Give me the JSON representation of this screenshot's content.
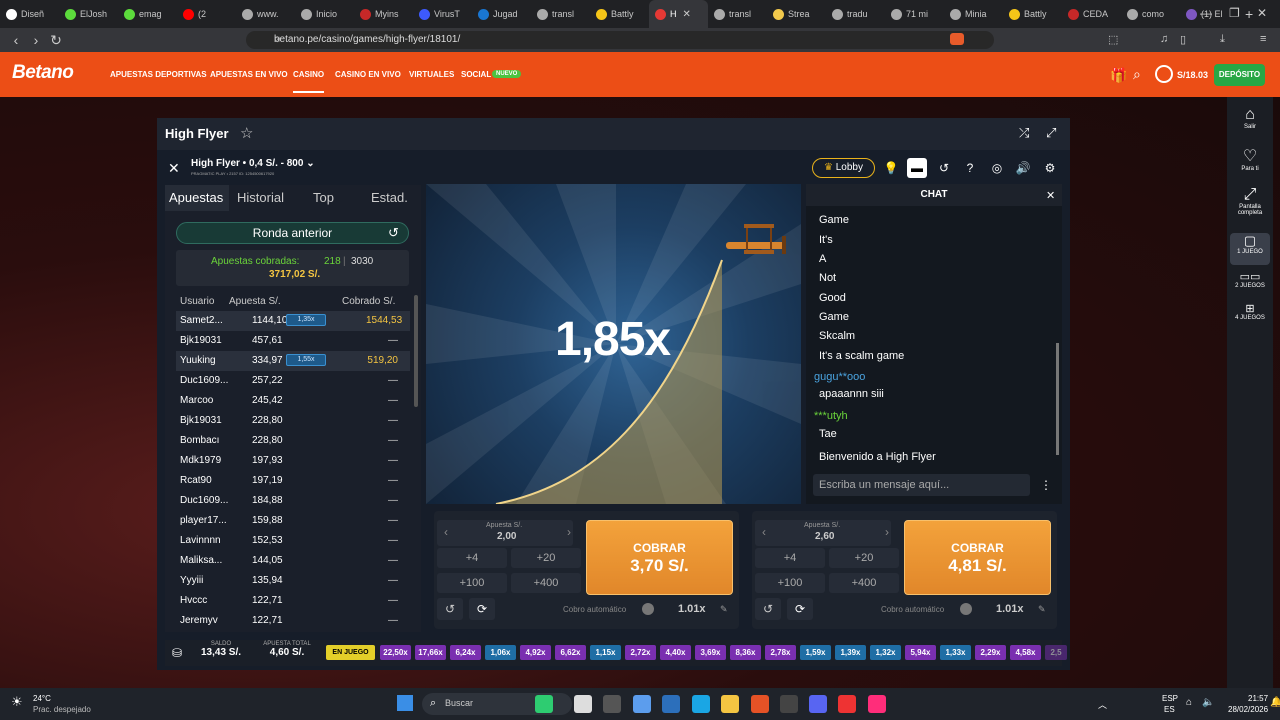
{
  "browser": {
    "tabs": [
      {
        "label": "Diseñ",
        "color": "#fff"
      },
      {
        "label": "ElJosh",
        "color": "#5cdb3c"
      },
      {
        "label": "emag",
        "color": "#5cdb3c"
      },
      {
        "label": "(2",
        "color": "#ff0000"
      },
      {
        "label": "www.",
        "color": "#aaa"
      },
      {
        "label": "Inicio",
        "color": "#aaa"
      },
      {
        "label": "Myins",
        "color": "#c62828"
      },
      {
        "label": "VirusT",
        "color": "#3d5afe"
      },
      {
        "label": "Jugad",
        "color": "#1976d2"
      },
      {
        "label": "transl",
        "color": "#aaa"
      },
      {
        "label": "Battly",
        "color": "#f5c518"
      },
      {
        "label": "H",
        "color": "#e53935"
      },
      {
        "label": "transl",
        "color": "#aaa"
      },
      {
        "label": "Strea",
        "color": "#f2c94c"
      },
      {
        "label": "tradu",
        "color": "#aaa"
      },
      {
        "label": "71 mi",
        "color": "#aaa"
      },
      {
        "label": "Minia",
        "color": "#aaa"
      },
      {
        "label": "Battly",
        "color": "#f5c518"
      },
      {
        "label": "CEDA",
        "color": "#c62828"
      },
      {
        "label": "como",
        "color": "#aaa"
      },
      {
        "label": "(1) El",
        "color": "#7e57c2"
      }
    ],
    "url": "betano.pe/casino/games/high-flyer/18101/"
  },
  "site": {
    "logo": "Betano",
    "nav": [
      "APUESTAS DEPORTIVAS",
      "APUESTAS EN VIVO",
      "CASINO",
      "CASINO EN VIVO",
      "VIRTUALES",
      "SOCIAL"
    ],
    "nuevo": "NUEVO",
    "balance": "S/18.03",
    "deposit": "DEPÓSITO"
  },
  "sidebar": [
    {
      "label": "Salir",
      "icon": "home-icon"
    },
    {
      "label": "Para ti",
      "icon": "heart-icon"
    },
    {
      "label": "Pantalla completa",
      "icon": "fullscreen-icon"
    },
    {
      "label": "1 JUEGO",
      "icon": "single-game-icon"
    },
    {
      "label": "2 JUEGOS",
      "icon": "two-games-icon"
    },
    {
      "label": "4 JUEGOS",
      "icon": "four-games-icon"
    }
  ],
  "game": {
    "frame_title": "High Flyer",
    "title": "High Flyer • 0,4 S/. - 800 ⌄",
    "subtitle": "PRAGMATIC PLAY • 2157  ID: 1254500617920",
    "lobby": "Lobby",
    "multiplier": "1,85x"
  },
  "left": {
    "tabs": [
      "Apuestas",
      "Historial",
      "Top",
      "Estad."
    ],
    "ronda": "Ronda anterior",
    "cobradas_label": "Apuestas cobradas:",
    "cobradas_a": "218",
    "cobradas_b": "3030",
    "total": "3717,02 S/.",
    "cols": [
      "Usuario",
      "Apuesta S/.",
      "Cobrado S/."
    ],
    "rows": [
      {
        "user": "Samet2...",
        "bet": "1144,10",
        "mult": "1,35x",
        "won": "1544,53",
        "hl": true
      },
      {
        "user": "Bjk19031",
        "bet": "457,61",
        "mult": "",
        "won": "—",
        "hl": false
      },
      {
        "user": "Yuuking",
        "bet": "334,97",
        "mult": "1,55x",
        "won": "519,20",
        "hl": true
      },
      {
        "user": "Duc1609...",
        "bet": "257,22",
        "mult": "",
        "won": "—",
        "hl": false
      },
      {
        "user": "Marcoo",
        "bet": "245,42",
        "mult": "",
        "won": "—",
        "hl": false
      },
      {
        "user": "Bjk19031",
        "bet": "228,80",
        "mult": "",
        "won": "—",
        "hl": false
      },
      {
        "user": "Bombacı",
        "bet": "228,80",
        "mult": "",
        "won": "—",
        "hl": false
      },
      {
        "user": "Mdk1979",
        "bet": "197,93",
        "mult": "",
        "won": "—",
        "hl": false
      },
      {
        "user": "Rcat90",
        "bet": "197,19",
        "mult": "",
        "won": "—",
        "hl": false
      },
      {
        "user": "Duc1609...",
        "bet": "184,88",
        "mult": "",
        "won": "—",
        "hl": false
      },
      {
        "user": "player17...",
        "bet": "159,88",
        "mult": "",
        "won": "—",
        "hl": false
      },
      {
        "user": "Lavinnnn",
        "bet": "152,53",
        "mult": "",
        "won": "—",
        "hl": false
      },
      {
        "user": "Maliksa...",
        "bet": "144,05",
        "mult": "",
        "won": "—",
        "hl": false
      },
      {
        "user": "Yyyiii",
        "bet": "135,94",
        "mult": "",
        "won": "—",
        "hl": false
      },
      {
        "user": "Hvccc",
        "bet": "122,71",
        "mult": "",
        "won": "—",
        "hl": false
      },
      {
        "user": "Jeremyv",
        "bet": "122,71",
        "mult": "",
        "won": "—",
        "hl": false
      }
    ]
  },
  "chat": {
    "title": "CHAT",
    "lines": [
      {
        "text": "Game",
        "type": "msg"
      },
      {
        "text": "It's",
        "type": "msg"
      },
      {
        "text": "A",
        "type": "msg"
      },
      {
        "text": "Not",
        "type": "msg"
      },
      {
        "text": "Good",
        "type": "msg"
      },
      {
        "text": "Game",
        "type": "msg"
      },
      {
        "text": "Skcalm",
        "type": "msg"
      },
      {
        "text": "It's a scalm game",
        "type": "msg"
      },
      {
        "text": "gugu**ooo",
        "type": "user",
        "color": "#4aa3df"
      },
      {
        "text": "apaaannn siii",
        "type": "msg"
      },
      {
        "text": "***utyh",
        "type": "user",
        "color": "#6bd43a"
      },
      {
        "text": "Tae",
        "type": "msg"
      },
      {
        "text": "Bienvenido a High Flyer",
        "type": "msg"
      }
    ],
    "placeholder": "Escriba un mensaje aquí..."
  },
  "bets": [
    {
      "label": "Apuesta S/.",
      "value": "2,00",
      "q": [
        "+4",
        "+20",
        "+100",
        "+400"
      ],
      "cobrar": "COBRAR",
      "amount": "3,70 S/.",
      "auto": "Cobro automático",
      "auto_val": "1.01x"
    },
    {
      "label": "Apuesta S/.",
      "value": "2,60",
      "q": [
        "+4",
        "+20",
        "+100",
        "+400"
      ],
      "cobrar": "COBRAR",
      "amount": "4,81 S/.",
      "auto": "Cobro automático",
      "auto_val": "1.01x"
    }
  ],
  "bottom": {
    "saldo_label": "SALDO",
    "saldo": "13,43 S/.",
    "total_label": "APUESTA TOTAL",
    "total": "4,60 S/.",
    "enjuego": "EN JUEGO",
    "history": [
      {
        "v": "22,50x",
        "c": "#7a2fb0"
      },
      {
        "v": "17,66x",
        "c": "#7a2fb0"
      },
      {
        "v": "6,24x",
        "c": "#7a2fb0"
      },
      {
        "v": "1,06x",
        "c": "#1f6ea5"
      },
      {
        "v": "4,92x",
        "c": "#7a2fb0"
      },
      {
        "v": "6,62x",
        "c": "#7a2fb0"
      },
      {
        "v": "1,15x",
        "c": "#1f6ea5"
      },
      {
        "v": "2,72x",
        "c": "#7a2fb0"
      },
      {
        "v": "4,40x",
        "c": "#7a2fb0"
      },
      {
        "v": "3,69x",
        "c": "#7a2fb0"
      },
      {
        "v": "8,36x",
        "c": "#7a2fb0"
      },
      {
        "v": "2,78x",
        "c": "#7a2fb0"
      },
      {
        "v": "1,59x",
        "c": "#1f6ea5"
      },
      {
        "v": "1,39x",
        "c": "#1f6ea5"
      },
      {
        "v": "1,32x",
        "c": "#1f6ea5"
      },
      {
        "v": "5,94x",
        "c": "#7a2fb0"
      },
      {
        "v": "1,33x",
        "c": "#1f6ea5"
      },
      {
        "v": "2,29x",
        "c": "#7a2fb0"
      },
      {
        "v": "4,58x",
        "c": "#7a2fb0"
      },
      {
        "v": "2,5",
        "c": "#7a2fb0"
      }
    ]
  },
  "taskbar": {
    "weather": "24°C",
    "weather_desc": "Prac. despejado",
    "search": "Buscar",
    "lang": "ESP",
    "lang2": "ES",
    "time": "21:57",
    "date": "28/02/2026"
  }
}
